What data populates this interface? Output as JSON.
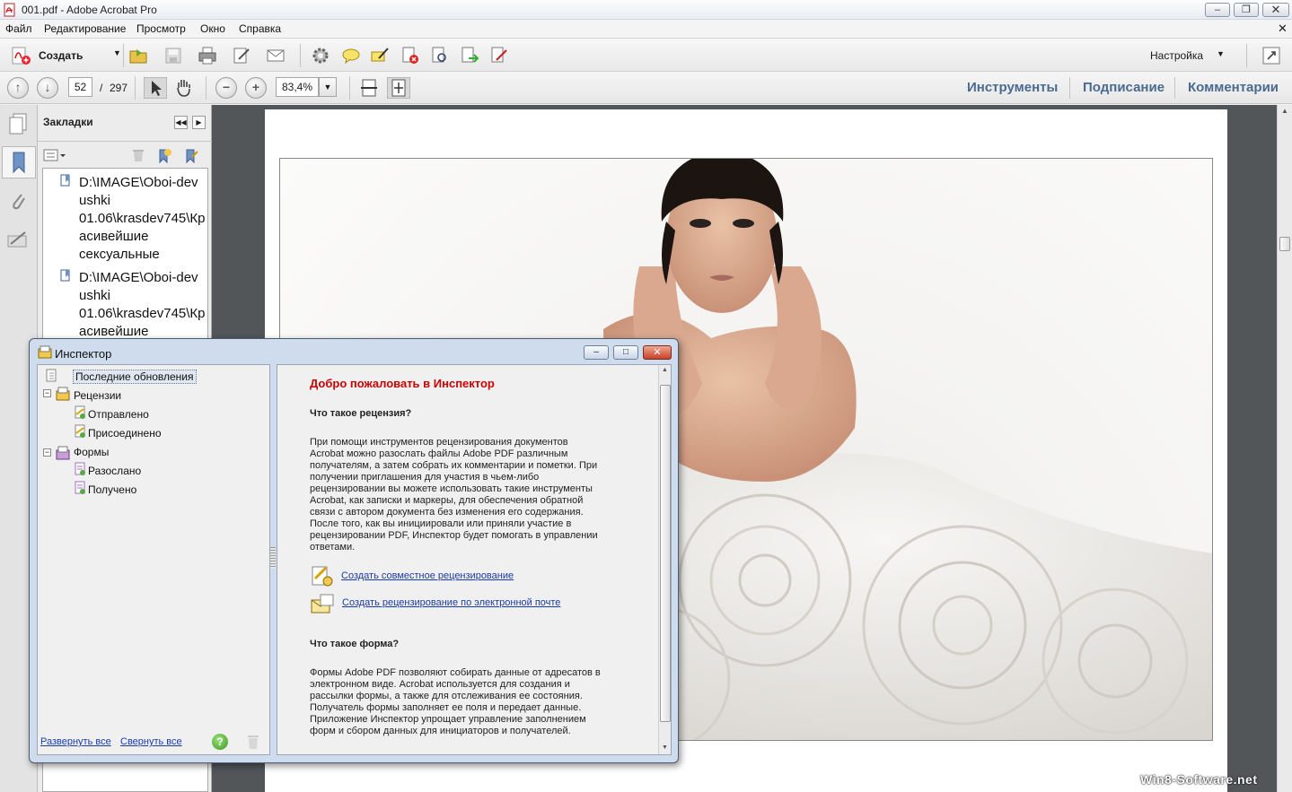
{
  "window": {
    "title": "001.pdf - Adobe Acrobat Pro"
  },
  "menu": [
    "Файл",
    "Редактирование",
    "Просмотр",
    "Окно",
    "Справка"
  ],
  "toolbar": {
    "create_label": "Создать",
    "customize_label": "Настройка"
  },
  "nav": {
    "current_page": "52",
    "page_sep": "/",
    "total_pages": "297",
    "zoom": "83,4%"
  },
  "panes": {
    "tools": "Инструменты",
    "sign": "Подписание",
    "comments": "Комментарии"
  },
  "bookmarks": {
    "title": "Закладки",
    "items": [
      [
        "D:\\IMAGE\\Oboi-dev",
        "ushki",
        "01.06\\krasdev745\\Кр",
        "асивейшие",
        "сексуальные"
      ],
      [
        "D:\\IMAGE\\Oboi-dev",
        "ushki",
        "01.06\\krasdev745\\Кр",
        "асивейшие"
      ]
    ]
  },
  "inspector": {
    "title": "Инспектор",
    "tree": {
      "recent": "Последние обновления",
      "reviews": "Рецензии",
      "sent": "Отправлено",
      "joined": "Присоединено",
      "forms": "Формы",
      "distributed": "Разослано",
      "received": "Получено"
    },
    "expand_all": "Развернуть все",
    "collapse_all": "Свернуть все",
    "welcome": "Добро пожаловать в Инспектор",
    "q1": "Что такое рецензия?",
    "p1": [
      "При помощи инструментов рецензирования документов",
      "Acrobat можно разослать файлы Adobe PDF различным",
      "получателям, а затем собрать их комментарии и пометки. При",
      "получении приглашения для участия в чьем-либо",
      "рецензировании вы можете использовать такие инструменты",
      "Acrobat, как записки и маркеры, для обеспечения обратной",
      "связи с автором документа без изменения его содержания.",
      "После того, как вы инициировали или приняли участие в",
      "рецензировании PDF, Инспектор будет помогать в управлении",
      "ответами."
    ],
    "link1": "Создать совместное рецензирование",
    "link2": "Создать рецензирование по электронной почте",
    "q2": "Что такое форма?",
    "p2": [
      "Формы Adobe PDF позволяют собирать данные от адресатов в",
      "электронном виде. Acrobat используется для создания и",
      "рассылки формы, а также для отслеживания ее состояния.",
      "Получатель формы заполняет ее поля и передает данные.",
      "Приложение Инспектор упрощает управление заполнением",
      "форм и сбором данных для инициаторов и получателей."
    ]
  },
  "watermark": "Win8-Software.net"
}
